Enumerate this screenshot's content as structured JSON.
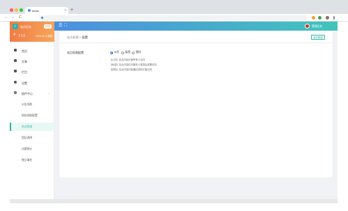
{
  "browser": {
    "tab_title": "bantu",
    "tab_close": "×",
    "new_tab": "+",
    "back": "←",
    "forward": "→",
    "reload": "C",
    "address": ""
  },
  "sidebar": {
    "brand_title": "站点后台",
    "brand_badge": "CMS",
    "user_name": "王五五",
    "date": "2019-10-17/周四",
    "items": [
      {
        "label": "首页",
        "icon": "home-icon"
      },
      {
        "label": "文章",
        "icon": "document-icon"
      },
      {
        "label": "栏目",
        "icon": "folder-icon"
      },
      {
        "label": "设置",
        "icon": "gear-icon"
      },
      {
        "label": "插件中心",
        "icon": "grid-icon",
        "arrow": "⌄"
      }
    ],
    "sub_items": [
      {
        "label": "公告导航",
        "active": false
      },
      {
        "label": "网站导航配置",
        "active": false
      },
      {
        "label": "站点权限",
        "active": true
      },
      {
        "label": "团队说明",
        "active": false
      },
      {
        "label": "访客统计",
        "active": false
      },
      {
        "label": "独立域名",
        "active": false
      }
    ]
  },
  "header": {
    "menu_icon": "☰",
    "expand_icon": "⛶",
    "user_label": "管理后台"
  },
  "content": {
    "breadcrumb_parent": "站点权限",
    "breadcrumb_sep": ">",
    "breadcrumb_current": "配置",
    "action_button": "操作教程",
    "field_label": "站点权限配置",
    "options": [
      {
        "label": "公开",
        "checked": true
      },
      {
        "label": "私密",
        "checked": false
      },
      {
        "label": "密码",
        "checked": false
      }
    ],
    "descriptions": [
      "【公开】站点内容可被所有人访问",
      "【私密】站点内容仅可被本人登录后查看访问",
      "【密码】站点内容只能通过密码才能访问"
    ]
  },
  "colors": {
    "accent": "#2fb4a8",
    "brand_orange": "#f07c45",
    "header_blue": "#4d8fe0"
  }
}
